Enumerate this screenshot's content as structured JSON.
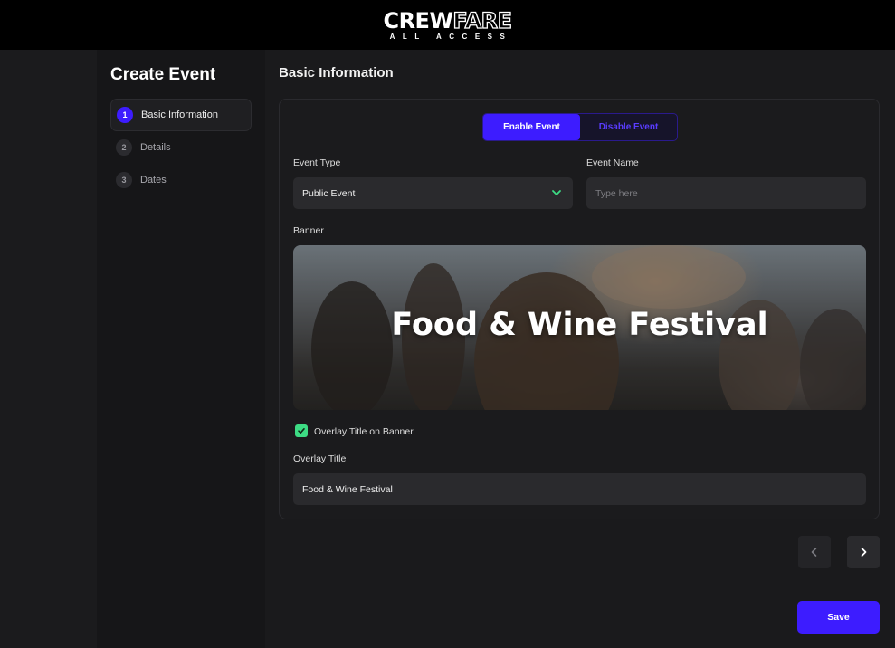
{
  "header": {
    "logo_main_a": "CREW",
    "logo_main_b": "FARE",
    "logo_sub": "ALL ACCESS"
  },
  "sidebar": {
    "title": "Create Event",
    "steps": [
      {
        "num": "1",
        "label": "Basic Information",
        "active": true
      },
      {
        "num": "2",
        "label": "Details",
        "active": false
      },
      {
        "num": "3",
        "label": "Dates",
        "active": false
      }
    ]
  },
  "main": {
    "title": "Basic Information",
    "toggle": {
      "enable_label": "Enable Event",
      "disable_label": "Disable Event",
      "selected": "Enable Event"
    },
    "event_type": {
      "label": "Event Type",
      "value": "Public Event"
    },
    "event_name": {
      "label": "Event Name",
      "placeholder": "Type here",
      "value": ""
    },
    "banner": {
      "label": "Banner",
      "overlay_text": "Food & Wine Festival"
    },
    "overlay_checkbox": {
      "label": "Overlay Title on Banner",
      "checked": true
    },
    "overlay_title": {
      "label": "Overlay Title",
      "value": "Food & Wine Festival"
    }
  },
  "footer": {
    "save_label": "Save",
    "prev_icon": "chevron-left-icon",
    "next_icon": "chevron-right-icon"
  },
  "colors": {
    "accent": "#3d1cff",
    "check": "#3ddc84",
    "chevron": "#3ddc84",
    "background": "#1a1a1c"
  }
}
